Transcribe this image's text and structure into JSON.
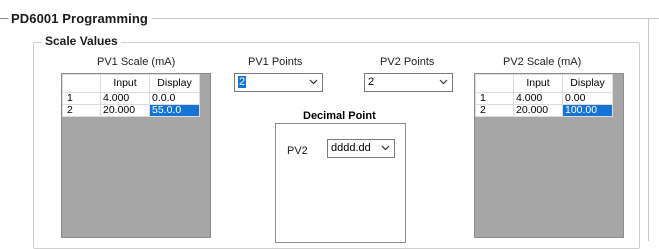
{
  "window": {
    "title": "PD6001 Programming"
  },
  "scale_group": {
    "title": "Scale Values"
  },
  "pv1_scale": {
    "label": "PV1 Scale (mA)",
    "headers": [
      "Input",
      "Display"
    ],
    "rows": [
      {
        "index": "1",
        "input": "4.000",
        "display": "0.0.0"
      },
      {
        "index": "2",
        "input": "20.000",
        "display": "55.0.0"
      }
    ]
  },
  "pv1_points": {
    "label": "PV1 Points",
    "value": "2"
  },
  "pv2_points": {
    "label": "PV2 Points",
    "value": "2"
  },
  "decimal_point": {
    "title": "Decimal Point",
    "pv2_label": "PV2",
    "pv2_value": "dddd.dd"
  },
  "pv2_scale": {
    "label": "PV2 Scale (mA)",
    "headers": [
      "Input",
      "Display"
    ],
    "rows": [
      {
        "index": "1",
        "input": "4.000",
        "display": "0.00"
      },
      {
        "index": "2",
        "input": "20.000",
        "display": "100.00"
      }
    ]
  },
  "colors": {
    "selection": "#1673d6",
    "grid_background": "#a6a6a6"
  },
  "icons": {
    "dropdown": "chevron-down-icon"
  }
}
